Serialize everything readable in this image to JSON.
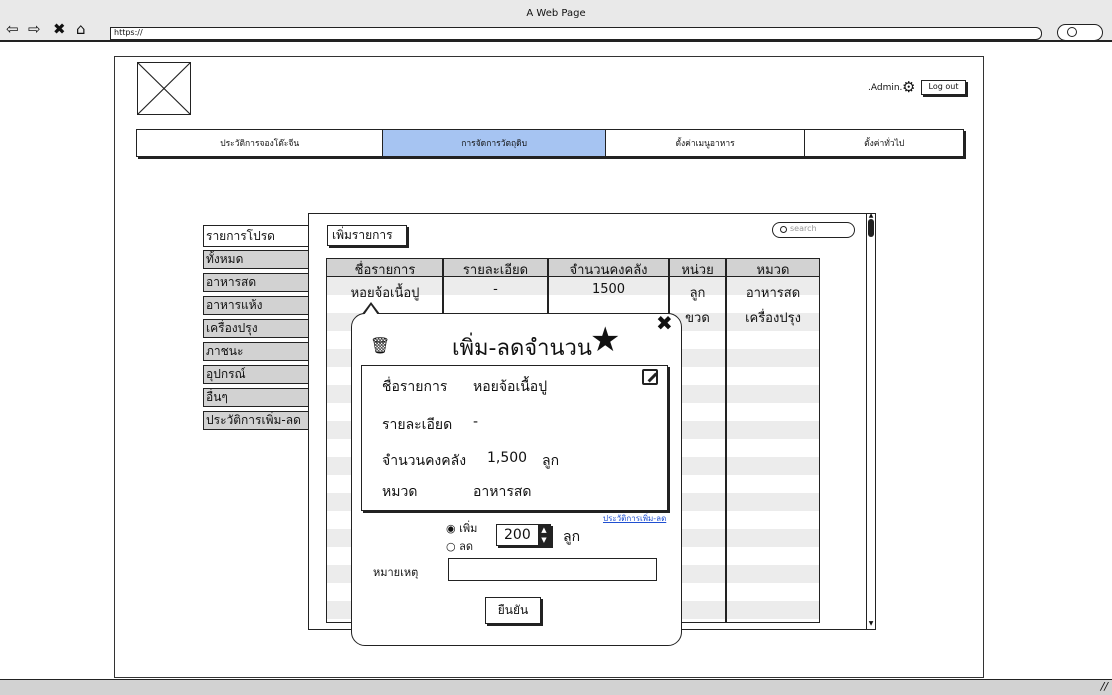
{
  "browser": {
    "window_title": "A Web Page",
    "url": "https://",
    "nav_icons": [
      "back-arrow-icon",
      "forward-arrow-icon",
      "close-icon",
      "home-icon"
    ]
  },
  "header": {
    "admin_label": ".Admin.",
    "logout_label": "Log out"
  },
  "tabs": [
    {
      "label": "ประวัติการจองโต๊ะจีน",
      "active": false
    },
    {
      "label": "การจัดการวัตถุดิบ",
      "active": true
    },
    {
      "label": "ตั้งค่าเมนูอาหาร",
      "active": false
    },
    {
      "label": "ตั้งค่าทั่วไป",
      "active": false
    }
  ],
  "side_menu": [
    "รายการโปรด",
    "ทั้งหมด",
    "อาหารสด",
    "อาหารแห้ง",
    "เครื่องปรุง",
    "ภาชนะ",
    "อุปกรณ์",
    "อื่นๆ",
    "ประวัติการเพิ่ม-ลด"
  ],
  "toolbar": {
    "add_label": "เพิ่มรายการ",
    "search_placeholder": "search"
  },
  "table": {
    "headers": [
      "ชื่อรายการ",
      "รายละเอียด",
      "จำนวนคงคลัง",
      "หน่วย",
      "หมวด"
    ],
    "rows": [
      [
        "หอยจ้อเนื้อปู",
        "-",
        "1500",
        "ลูก",
        "อาหารสด"
      ],
      [
        "",
        "",
        "",
        "ขวด",
        "เครื่องปรุง"
      ]
    ]
  },
  "modal": {
    "title": "เพิ่ม-ลดจำนวน",
    "fields": {
      "name_label": "ชื่อรายการ",
      "name_value": "หอยจ้อเนื้อปู",
      "detail_label": "รายละเอียด",
      "detail_value": "-",
      "stock_label": "จำนวนคงคลัง",
      "stock_value": "1,500",
      "stock_unit": "ลูก",
      "category_label": "หมวด",
      "category_value": "อาหารสด"
    },
    "history_link": "ประวัติการเพิ่ม-ลด",
    "radio_add": "เพิ่ม",
    "radio_remove": "ลด",
    "selected_mode": "เพิ่ม",
    "amount": "200",
    "amount_unit": "ลูก",
    "note_label": "หมายเหตุ",
    "note_value": "",
    "confirm_label": "ยืนยัน"
  }
}
